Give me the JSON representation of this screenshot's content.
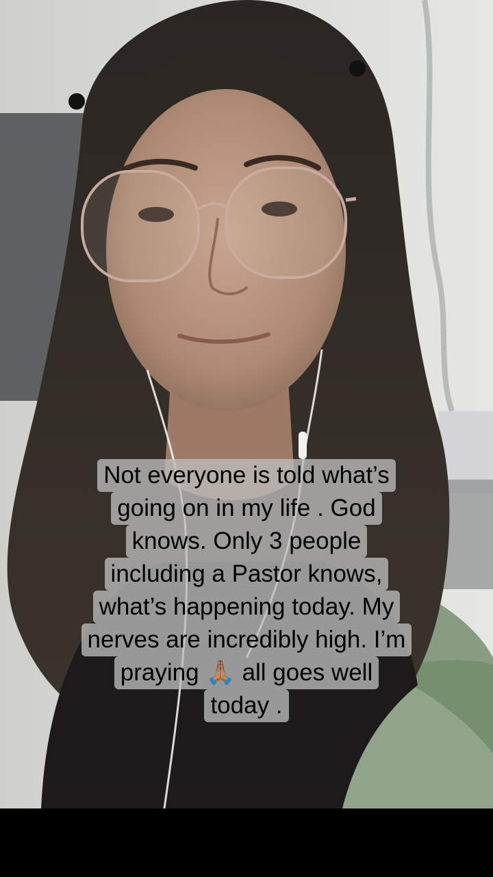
{
  "video": {
    "description_icon": "selfie-video-frame",
    "caption_lines": [
      "Not everyone is told what’s",
      "going on in my life . God",
      "knows. Only 3 people",
      "including a Pastor knows,",
      "what’s happening today. My",
      "nerves are incredibly high. I’m",
      "praying 🙏🏽 all goes well",
      "today ."
    ]
  },
  "colors": {
    "caption_background": "#bcbcbc",
    "caption_text": "#000000",
    "bottom_bar": "#000000"
  }
}
